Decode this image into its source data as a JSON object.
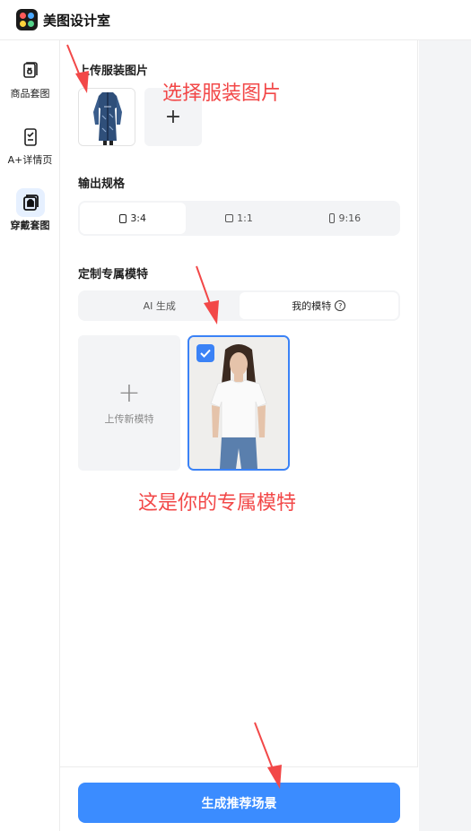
{
  "app": {
    "brand": "美图设计室"
  },
  "sidebar": {
    "items": [
      {
        "label": "商品套图",
        "icon": "product-set-icon",
        "active": false
      },
      {
        "label": "A+详情页",
        "icon": "detail-page-icon",
        "active": false
      },
      {
        "label": "穿戴套图",
        "icon": "wear-set-icon",
        "active": true
      }
    ]
  },
  "upload_garment": {
    "title": "上传服装图片",
    "add_label": "+"
  },
  "output_spec": {
    "title": "输出规格",
    "options": [
      {
        "label": "3:4",
        "active": true
      },
      {
        "label": "1:1",
        "active": false
      },
      {
        "label": "9:16",
        "active": false
      }
    ]
  },
  "custom_model": {
    "title": "定制专属模特",
    "tabs": [
      {
        "label": "AI 生成",
        "active": false
      },
      {
        "label": "我的模特",
        "active": true,
        "icon": "help-icon"
      }
    ],
    "upload_label": "上传新模特",
    "upload_plus": "+",
    "selected_model": true
  },
  "footer": {
    "generate_label": "生成推荐场景"
  },
  "annotations": {
    "select_garment": "选择服装图片",
    "your_model": "这是你的专属模特",
    "color": "#f24848"
  },
  "colors": {
    "accent": "#3b8cff",
    "selected_border": "#3b82f6"
  }
}
